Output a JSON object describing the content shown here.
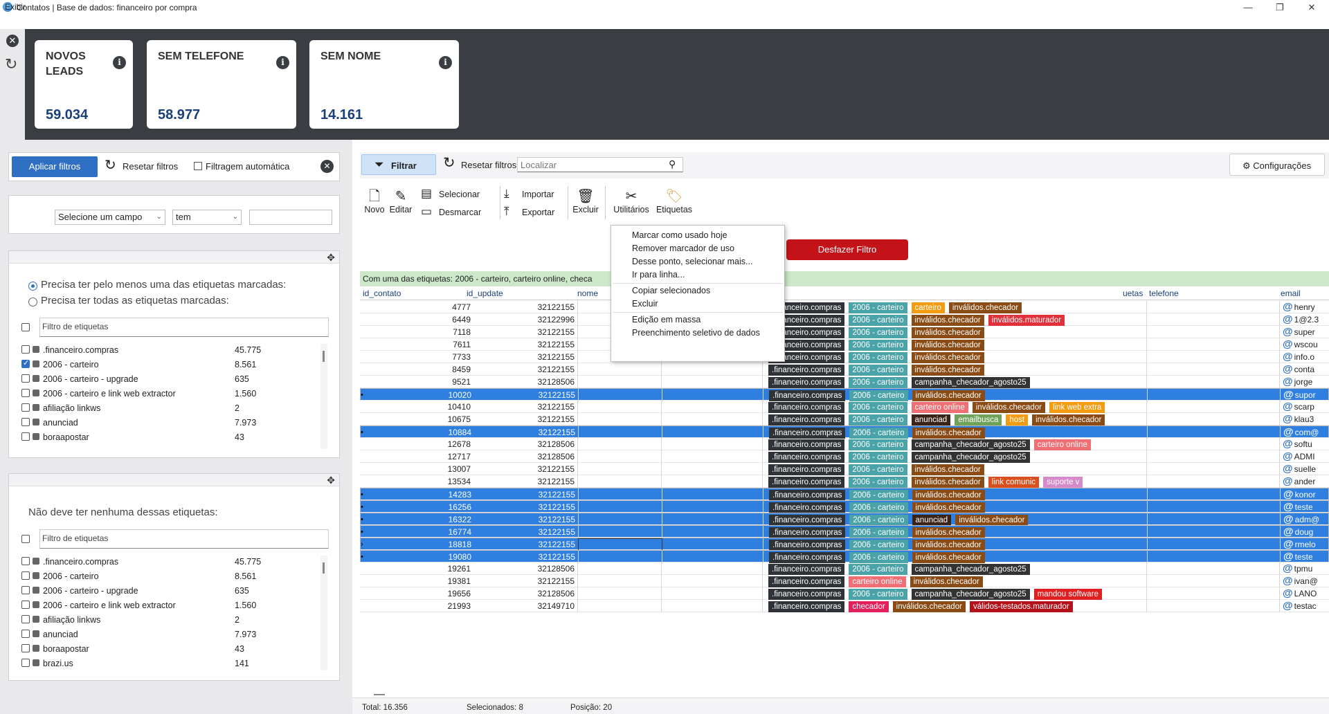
{
  "window": {
    "title": "Contatos | Base de dados: financeiro por compra",
    "min": "—",
    "restore": "❐",
    "close": "✕"
  },
  "menu": {
    "exibir": "Exibir"
  },
  "kpis": [
    {
      "title": "NOVOS LEADS",
      "value": "59.034"
    },
    {
      "title": "SEM TELEFONE",
      "value": "58.977"
    },
    {
      "title": "SEM NOME",
      "value": "14.161"
    }
  ],
  "filters": {
    "apply": "Aplicar filtros",
    "reset": "Resetar filtros",
    "auto": "Filtragem automática",
    "field_select": "Selecione um campo",
    "op_select": "tem",
    "field_value": ""
  },
  "include_panel": {
    "radio_any": "Precisa ter pelo menos uma das etiquetas marcadas:",
    "radio_all": "Precisa ter todas as etiquetas marcadas:",
    "filter_placeholder": "Filtro de etiquetas",
    "tags": [
      {
        "name": ".financeiro.compras",
        "count": "45.775",
        "checked": false
      },
      {
        "name": "2006 - carteiro",
        "count": "8.561",
        "checked": true
      },
      {
        "name": "2006 - carteiro - upgrade",
        "count": "635",
        "checked": false
      },
      {
        "name": "2006 - carteiro e link web extractor",
        "count": "1.560",
        "checked": false
      },
      {
        "name": "afiliação linkws",
        "count": "2",
        "checked": false
      },
      {
        "name": "anunciad",
        "count": "7.973",
        "checked": false
      },
      {
        "name": "boraapostar",
        "count": "43",
        "checked": false
      }
    ]
  },
  "exclude_panel": {
    "title": "Não deve ter nenhuma dessas etiquetas:",
    "filter_placeholder": "Filtro de etiquetas",
    "tags": [
      {
        "name": ".financeiro.compras",
        "count": "45.775"
      },
      {
        "name": "2006 - carteiro",
        "count": "8.561"
      },
      {
        "name": "2006 - carteiro - upgrade",
        "count": "635"
      },
      {
        "name": "2006 - carteiro e link web extractor",
        "count": "1.560"
      },
      {
        "name": "afiliação linkws",
        "count": "2"
      },
      {
        "name": "anunciad",
        "count": "7.973"
      },
      {
        "name": "boraapostar",
        "count": "43"
      },
      {
        "name": "brazi.us",
        "count": "141"
      }
    ]
  },
  "toolbar": {
    "filtrar": "Filtrar",
    "reset": "Resetar filtros",
    "search_placeholder": "Localizar",
    "config": "Configurações",
    "novo": "Novo",
    "editar": "Editar",
    "selecionar": "Selecionar",
    "desmarcar": "Desmarcar",
    "importar": "Importar",
    "exportar": "Exportar",
    "excluir": "Excluir",
    "utilitarios": "Utilitários",
    "etiquetas": "Etiquetas"
  },
  "desfazer": "Desfazer Filtro",
  "filter_banner": "Com uma das etiquetas: 2006 - carteiro, carteiro online, checa",
  "context_menu": [
    [
      "Marcar como usado hoje",
      "Remover marcador de uso",
      "Desse ponto, selecionar mais...",
      "Ir para linha..."
    ],
    [
      "Copiar selecionados",
      "Excluir"
    ],
    [
      "Edição em massa",
      "Preenchimento seletivo de dados"
    ]
  ],
  "columns": {
    "id": "id_contato",
    "upd": "id_update",
    "nome": "nome",
    "tags": "etiquetas",
    "tags_visible": "uetas",
    "tel": "telefone",
    "email": "email"
  },
  "tag_colors": {
    ".financeiro.compras": "#2f3338",
    "2006 - carteiro": "#4aa3a8",
    "carteiro": "#f39c12",
    "inválidos.checador": "#8a4b14",
    "inválidos.maturador": "#e0303a",
    "campanha_checador_agosto25": "#333333",
    "carteiro online": "#ef6f74",
    "link web extra": "#f39c12",
    "anunciad": "#3a2418",
    "emailbusca": "#6fa35a",
    "host": "#f39c12",
    "link comunic": "#d9501e",
    "suporte v": "#d68ac9",
    "mandou software": "#e02020",
    "checador": "#e2205a",
    "válidos-testados.maturador": "#b3121a"
  },
  "rows": [
    {
      "id": "4777",
      "upd": "32122155",
      "tags": [
        ".financeiro.compras",
        "2006 - carteiro",
        "carteiro",
        "inválidos.checador"
      ],
      "email": "henry",
      "sel": false
    },
    {
      "id": "6449",
      "upd": "32122996",
      "tags": [
        ".financeiro.compras",
        "2006 - carteiro",
        "inválidos.checador",
        "inválidos.maturador"
      ],
      "email": "1@2.3",
      "sel": false
    },
    {
      "id": "7118",
      "upd": "32122155",
      "tags": [
        ".financeiro.compras",
        "2006 - carteiro",
        "inválidos.checador"
      ],
      "email": "super",
      "sel": false
    },
    {
      "id": "7611",
      "upd": "32122155",
      "tags": [
        ".financeiro.compras",
        "2006 - carteiro",
        "inválidos.checador"
      ],
      "email": "wscou",
      "sel": false
    },
    {
      "id": "7733",
      "upd": "32122155",
      "tags": [
        ".financeiro.compras",
        "2006 - carteiro",
        "inválidos.checador"
      ],
      "email": "info.o",
      "sel": false
    },
    {
      "id": "8459",
      "upd": "32122155",
      "tags": [
        ".financeiro.compras",
        "2006 - carteiro",
        "inválidos.checador"
      ],
      "email": "conta",
      "sel": false
    },
    {
      "id": "9521",
      "upd": "32128506",
      "tags": [
        ".financeiro.compras",
        "2006 - carteiro",
        "campanha_checador_agosto25"
      ],
      "email": "jorge",
      "sel": false
    },
    {
      "id": "10020",
      "upd": "32122155",
      "tags": [
        ".financeiro.compras",
        "2006 - carteiro",
        "inválidos.checador"
      ],
      "email": "supor",
      "sel": true
    },
    {
      "id": "10410",
      "upd": "32122155",
      "tags": [
        ".financeiro.compras",
        "2006 - carteiro",
        "carteiro online",
        "inválidos.checador",
        "link web extra"
      ],
      "email": "scarp",
      "sel": false
    },
    {
      "id": "10675",
      "upd": "32122155",
      "tags": [
        ".financeiro.compras",
        "2006 - carteiro",
        "anunciad",
        "emailbusca",
        "host",
        "inválidos.checador"
      ],
      "email": "klau3",
      "sel": false
    },
    {
      "id": "10884",
      "upd": "32122155",
      "tags": [
        ".financeiro.compras",
        "2006 - carteiro",
        "inválidos.checador"
      ],
      "email": "com@",
      "sel": true
    },
    {
      "id": "12678",
      "upd": "32128506",
      "tags": [
        ".financeiro.compras",
        "2006 - carteiro",
        "campanha_checador_agosto25",
        "carteiro online"
      ],
      "email": "softu",
      "sel": false
    },
    {
      "id": "12717",
      "upd": "32128506",
      "tags": [
        ".financeiro.compras",
        "2006 - carteiro",
        "campanha_checador_agosto25"
      ],
      "email": "ADMI",
      "sel": false
    },
    {
      "id": "13007",
      "upd": "32122155",
      "tags": [
        ".financeiro.compras",
        "2006 - carteiro",
        "inválidos.checador"
      ],
      "email": "suelle",
      "sel": false
    },
    {
      "id": "13534",
      "upd": "32122155",
      "tags": [
        ".financeiro.compras",
        "2006 - carteiro",
        "inválidos.checador",
        "link comunic",
        "suporte v"
      ],
      "email": "ander",
      "sel": false
    },
    {
      "id": "14283",
      "upd": "32122155",
      "tags": [
        ".financeiro.compras",
        "2006 - carteiro",
        "inválidos.checador"
      ],
      "email": "konor",
      "sel": true
    },
    {
      "id": "16256",
      "upd": "32122155",
      "tags": [
        ".financeiro.compras",
        "2006 - carteiro",
        "inválidos.checador"
      ],
      "email": "teste",
      "sel": true
    },
    {
      "id": "16322",
      "upd": "32122155",
      "tags": [
        ".financeiro.compras",
        "2006 - carteiro",
        "anunciad",
        "inválidos.checador"
      ],
      "email": "adm@",
      "sel": true
    },
    {
      "id": "16774",
      "upd": "32122155",
      "tags": [
        ".financeiro.compras",
        "2006 - carteiro",
        "inválidos.checador"
      ],
      "email": "doug",
      "sel": true
    },
    {
      "id": "18818",
      "upd": "32122155",
      "tags": [
        ".financeiro.compras",
        "2006 - carteiro",
        "inválidos.checador"
      ],
      "email": "rmelo",
      "sel": true,
      "current": true
    },
    {
      "id": "19080",
      "upd": "32122155",
      "tags": [
        ".financeiro.compras",
        "2006 - carteiro",
        "inválidos.checador"
      ],
      "email": "teste",
      "sel": true
    },
    {
      "id": "19261",
      "upd": "32128506",
      "tags": [
        ".financeiro.compras",
        "2006 - carteiro",
        "campanha_checador_agosto25"
      ],
      "email": "tpmu",
      "sel": false
    },
    {
      "id": "19381",
      "upd": "32122155",
      "tags": [
        ".financeiro.compras",
        "carteiro online",
        "inválidos.checador"
      ],
      "email": "ivan@",
      "sel": false
    },
    {
      "id": "19656",
      "upd": "32128506",
      "tags": [
        ".financeiro.compras",
        "2006 - carteiro",
        "campanha_checador_agosto25",
        "mandou software"
      ],
      "email": "LANO",
      "sel": false
    },
    {
      "id": "21993",
      "upd": "32149710",
      "tags": [
        ".financeiro.compras",
        "checador",
        "inválidos.checador",
        "válidos-testados.maturador"
      ],
      "email": "testac",
      "sel": false
    }
  ],
  "footer": {
    "total": "Total: 16.356",
    "selecionados": "Selecionados: 8",
    "posicao": "Posição: 20"
  }
}
